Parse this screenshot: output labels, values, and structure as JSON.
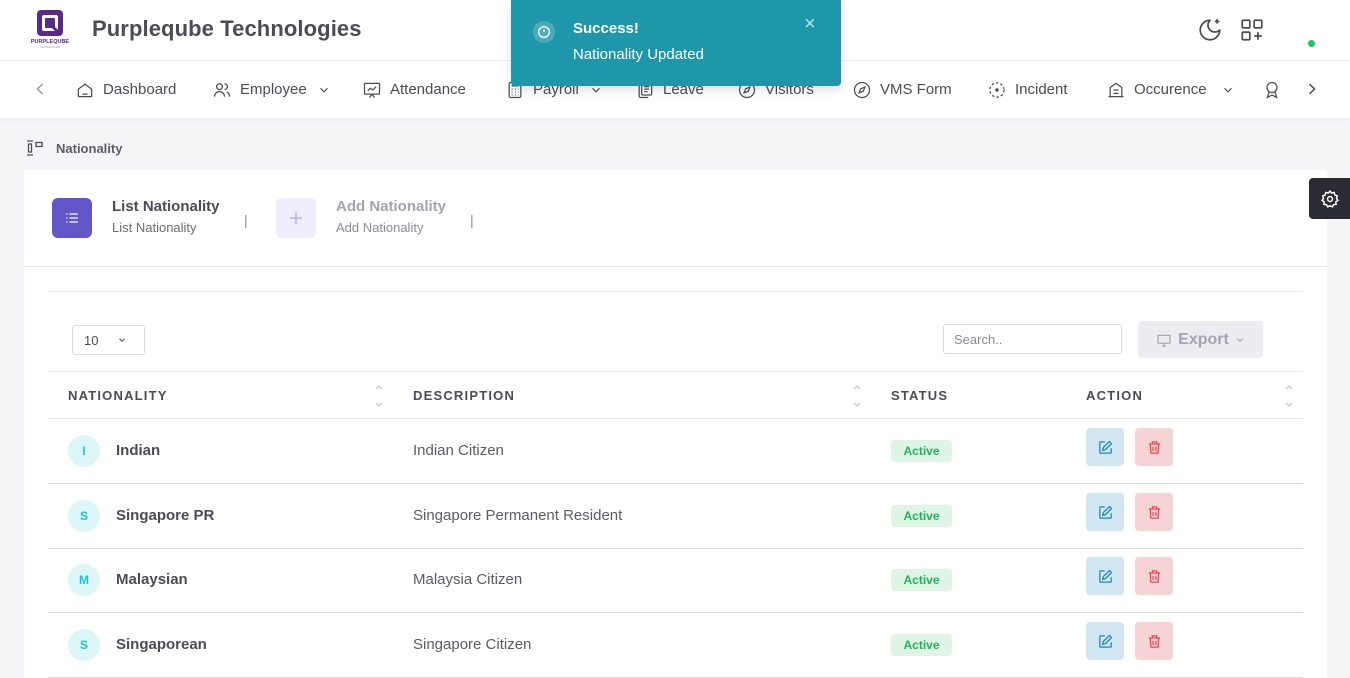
{
  "app": {
    "brand": "Purpleqube Technologies",
    "logo_text": "PURPLEQUBE"
  },
  "toast": {
    "title": "Success!",
    "message": "Nationality Updated",
    "close": "×"
  },
  "nav": {
    "items": [
      {
        "label": "Dashboard",
        "icon": "home-icon"
      },
      {
        "label": "Employee",
        "icon": "users-icon",
        "dropdown": true
      },
      {
        "label": "Attendance",
        "icon": "presentation-icon"
      },
      {
        "label": "Payroll",
        "icon": "calculator-icon",
        "dropdown": true
      },
      {
        "label": "Leave",
        "icon": "copy-icon"
      },
      {
        "label": "Visitors",
        "icon": "compass-icon"
      },
      {
        "label": "VMS Form",
        "icon": "compass-icon"
      },
      {
        "label": "Incident",
        "icon": "focus-icon"
      },
      {
        "label": "Occurence",
        "icon": "building-icon",
        "dropdown": true
      }
    ]
  },
  "breadcrumb": {
    "current": "Nationality"
  },
  "tabs": [
    {
      "title": "List Nationality",
      "subtitle": "List Nationality",
      "active": true
    },
    {
      "title": "Add Nationality",
      "subtitle": "Add Nationality",
      "active": false
    }
  ],
  "tab_separator": "|",
  "table_controls": {
    "page_size": "10",
    "search_placeholder": "Search..",
    "export_label": "Export"
  },
  "table": {
    "columns": [
      "NATIONALITY",
      "DESCRIPTION",
      "STATUS",
      "ACTION"
    ],
    "rows": [
      {
        "initial": "I",
        "nationality": "Indian",
        "description": "Indian Citizen",
        "status": "Active"
      },
      {
        "initial": "S",
        "nationality": "Singapore PR",
        "description": "Singapore Permanent Resident",
        "status": "Active"
      },
      {
        "initial": "M",
        "nationality": "Malaysian",
        "description": "Malaysia Citizen",
        "status": "Active"
      },
      {
        "initial": "S",
        "nationality": "Singaporean",
        "description": "Singapore Citizen",
        "status": "Active"
      }
    ]
  },
  "colors": {
    "primary": "#6255c9",
    "toast": "#1e97ab",
    "active": "#22b35a",
    "edit_bg": "#d2e6f1",
    "delete_bg": "#f6d3d5"
  }
}
